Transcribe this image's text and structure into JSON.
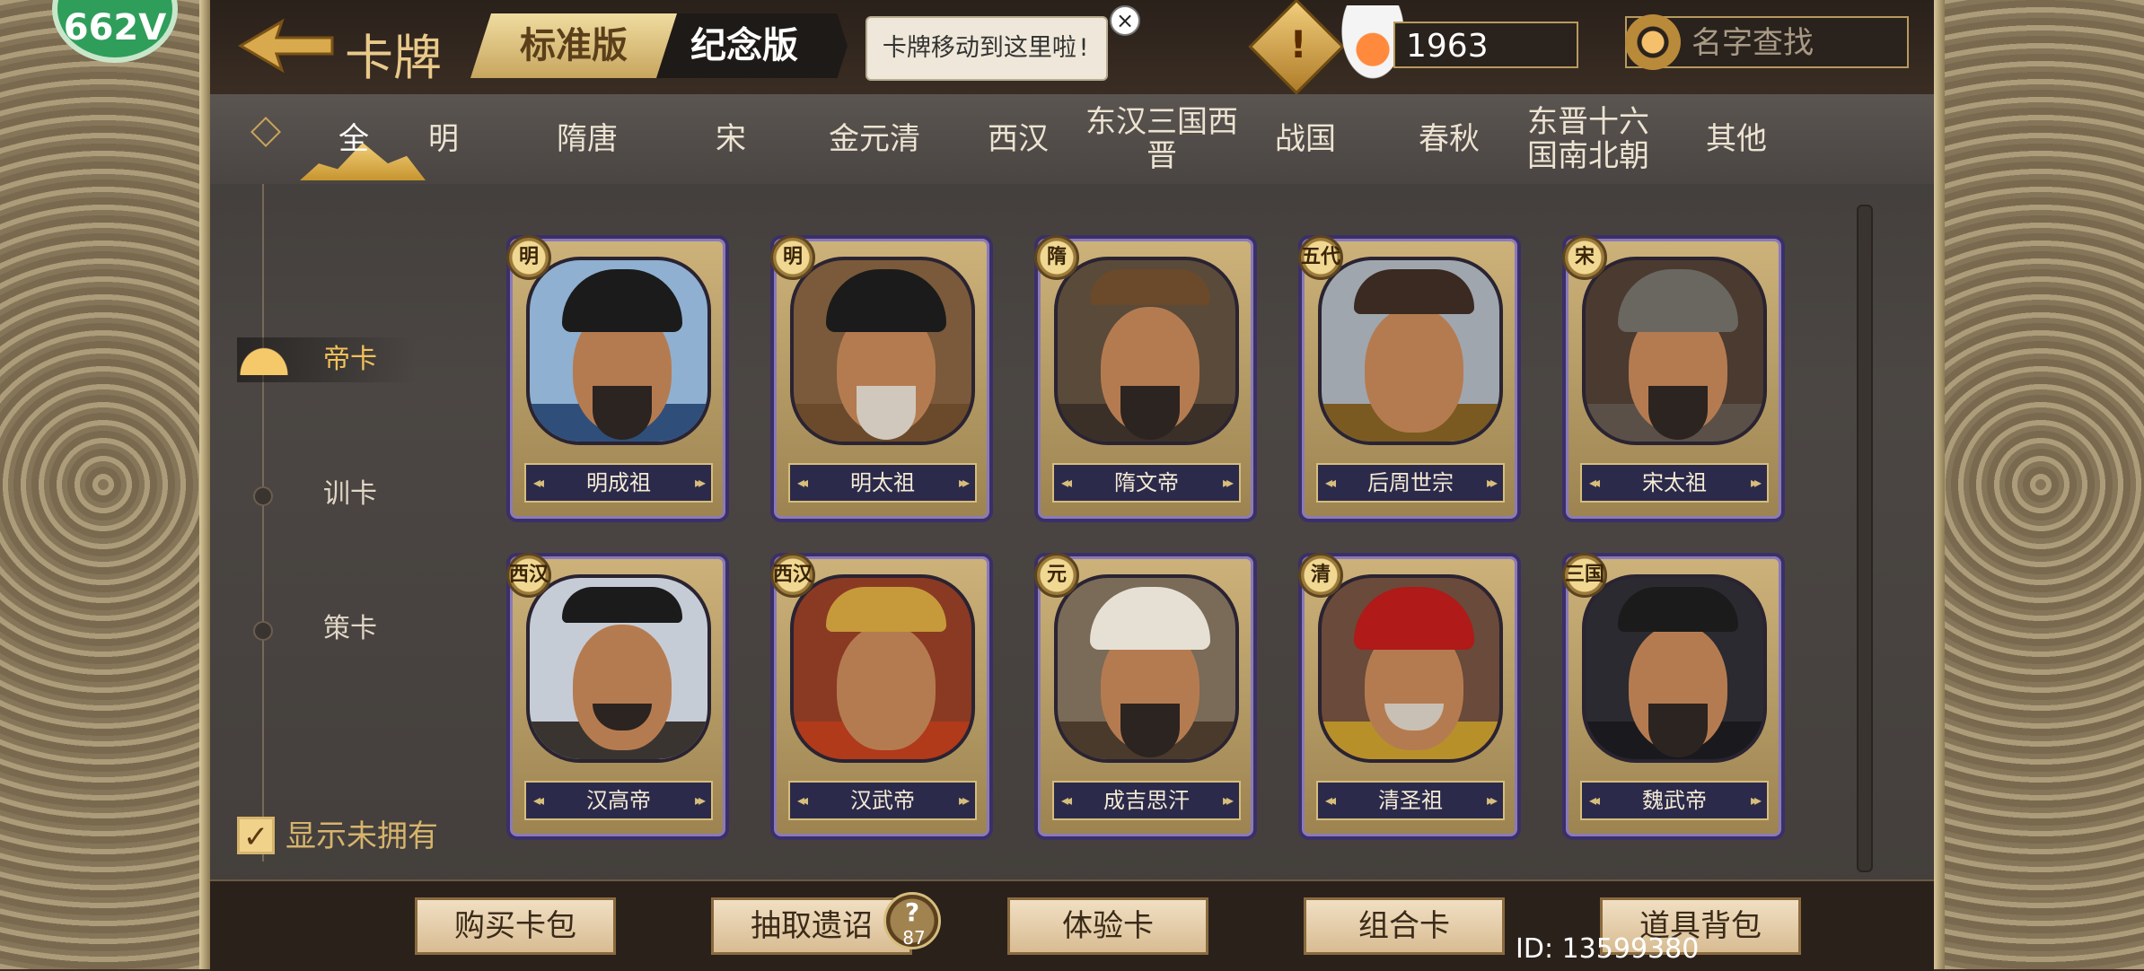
{
  "header": {
    "title": "卡牌",
    "version_tabs": [
      "标准版",
      "纪念版"
    ],
    "tooltip": "卡牌移动到这里啦!",
    "currency_value": "1963",
    "search_placeholder": "名字查找"
  },
  "top_left_badge": "662V",
  "dynasty_tabs": [
    "全",
    "明",
    "隋唐",
    "宋",
    "金元清",
    "西汉",
    "东汉三国西晋",
    "战国",
    "春秋",
    "东晋十六国南北朝",
    "其他"
  ],
  "categories": [
    "帝卡",
    "训卡",
    "策卡"
  ],
  "show_unowned_label": "显示未拥有",
  "cards": [
    {
      "badge": "明",
      "name": "明成祖"
    },
    {
      "badge": "明",
      "name": "明太祖"
    },
    {
      "badge": "隋",
      "name": "隋文帝"
    },
    {
      "badge": "五代",
      "name": "后周世宗"
    },
    {
      "badge": "宋",
      "name": "宋太祖"
    },
    {
      "badge": "西汉",
      "name": "汉高帝"
    },
    {
      "badge": "西汉",
      "name": "汉武帝"
    },
    {
      "badge": "元",
      "name": "成吉思汗"
    },
    {
      "badge": "清",
      "name": "清圣祖"
    },
    {
      "badge": "三国",
      "name": "魏武帝"
    }
  ],
  "bottom_buttons": [
    "购买卡包",
    "抽取遗诏",
    "体验卡",
    "组合卡",
    "道具背包"
  ],
  "scroll_count": "87",
  "scroll_icon_glyph": "?",
  "user_id": "ID: 13599380",
  "colors": {
    "accent_gold": "#e9c98a",
    "plate_bg": "#2c2a4a",
    "main_bg": "#4b4643"
  }
}
